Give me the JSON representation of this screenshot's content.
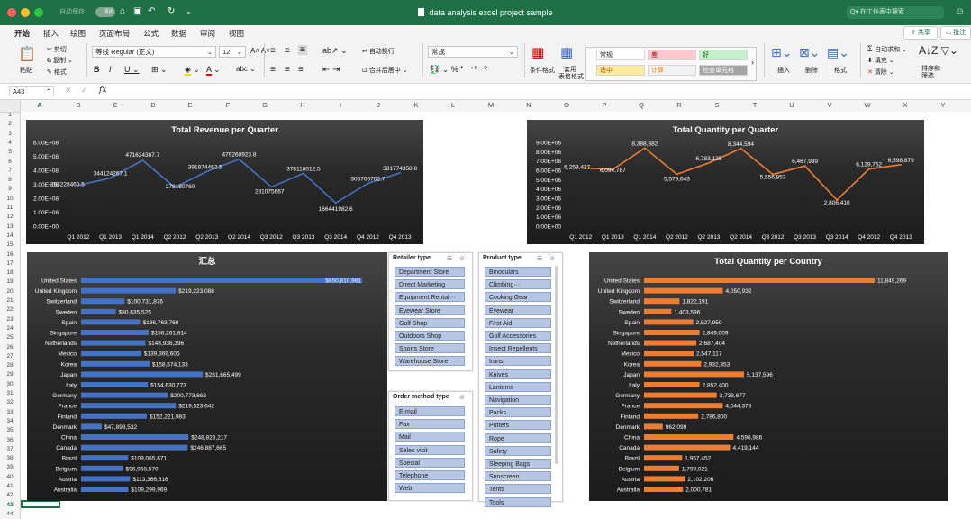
{
  "titlebar": {
    "title": "data analysis excel project sample",
    "autosave_label": "自动保存",
    "autosave_toggle": "关闭",
    "search_placeholder": "在工作表中搜索"
  },
  "menu": {
    "items": [
      "开始",
      "插入",
      "绘图",
      "页面布局",
      "公式",
      "数据",
      "审阅",
      "视图"
    ],
    "share": "共享",
    "comment": "批注"
  },
  "ribbon": {
    "paste": "粘贴",
    "cut": "剪切",
    "copy": "复制",
    "format_painter": "格式",
    "font_name": "等线 Regular (正文)",
    "font_size": "12",
    "wrap_text": "自动换行",
    "merge_center": "合并后居中",
    "number_format": "常规",
    "conditional_format": "条件格式",
    "table_format_1": "套用",
    "table_format_2": "表格格式",
    "styles": [
      {
        "label": "常规",
        "bg": "#ffffff",
        "fg": "#222222"
      },
      {
        "label": "差",
        "bg": "#ffc7ce",
        "fg": "#9c0006"
      },
      {
        "label": "好",
        "bg": "#c6efce",
        "fg": "#006100"
      },
      {
        "label": "适中",
        "bg": "#ffeb9c",
        "fg": "#9c5700"
      },
      {
        "label": "计算",
        "bg": "#f2f2f2",
        "fg": "#fa7d00"
      },
      {
        "label": "检查单元格",
        "bg": "#a5a5a5",
        "fg": "#ffffff"
      }
    ],
    "insert": "插入",
    "delete": "删除",
    "format": "格式",
    "autosum": "自动求和",
    "fill": "填充",
    "clear": "清除",
    "sort_filter_1": "排序和",
    "sort_filter_2": "筛选"
  },
  "formula_bar": {
    "cell_ref": "A43",
    "fx": "fx",
    "formula": ""
  },
  "columns": [
    "A",
    "B",
    "C",
    "D",
    "E",
    "F",
    "G",
    "H",
    "I",
    "J",
    "K",
    "L",
    "M",
    "N",
    "O",
    "P",
    "Q",
    "R",
    "S",
    "T",
    "U",
    "V",
    "W",
    "X",
    "Y"
  ],
  "rows": [
    "1",
    "2",
    "3",
    "4",
    "5",
    "6",
    "7",
    "8",
    "9",
    "10",
    "11",
    "12",
    "13",
    "14",
    "15",
    "16",
    "17",
    "18",
    "19",
    "20",
    "21",
    "22",
    "23",
    "24",
    "25",
    "26",
    "27",
    "28",
    "29",
    "30",
    "31",
    "32",
    "33",
    "34",
    "35",
    "36",
    "37",
    "38",
    "39",
    "40",
    "41",
    "42",
    "43",
    "44"
  ],
  "chart_data": [
    {
      "id": "revenue-quarter",
      "type": "line",
      "title": "Total Revenue per Quarter",
      "categories": [
        "Q1 2012",
        "Q1 2013",
        "Q1 2014",
        "Q2 2012",
        "Q2 2013",
        "Q2 2014",
        "Q3 2012",
        "Q3 2013",
        "Q3 2014",
        "Q4 2012",
        "Q4 2013"
      ],
      "values": [
        293228460.5,
        344124267.1,
        471624367.7,
        278180760,
        391874462.5,
        479260923.8,
        281075667,
        378118012.5,
        166441982.6,
        306706702.7,
        381774358.8
      ],
      "labels": [
        "293228460.5",
        "344124267.1",
        "471624367.7",
        "278180760",
        "391874462.5",
        "479260923.8",
        "281075667",
        "378118012.5",
        "166441982.6",
        "306706702.7",
        "381774358.8"
      ],
      "yticks": [
        "0.00E+00",
        "1.00E+08",
        "2.00E+08",
        "3.00E+08",
        "4.00E+08",
        "5.00E+08",
        "6.00E+08"
      ],
      "ylim": [
        0,
        600000000
      ],
      "color": "#4472c4"
    },
    {
      "id": "quantity-quarter",
      "type": "line",
      "title": "Total Quantity per Quarter",
      "categories": [
        "Q1 2012",
        "Q1 2013",
        "Q1 2014",
        "Q2 2012",
        "Q2 2013",
        "Q2 2014",
        "Q3 2012",
        "Q3 2013",
        "Q3 2014",
        "Q4 2012",
        "Q4 2013"
      ],
      "values": [
        6258427,
        6094787,
        8388882,
        5579643,
        6783135,
        8344594,
        5556853,
        6467989,
        2806410,
        6129762,
        6598879
      ],
      "labels": [
        "6,258,427",
        "6,094,787",
        "8,388,882",
        "5,579,643",
        "6,783,135",
        "8,344,594",
        "5,556,853",
        "6,467,989",
        "2,806,410",
        "6,129,762",
        "6,598,879"
      ],
      "yticks": [
        "0.00E+00",
        "1.00E+06",
        "2.00E+06",
        "3.00E+06",
        "4.00E+06",
        "5.00E+06",
        "6.00E+06",
        "7.00E+06",
        "8.00E+06",
        "9.00E+06"
      ],
      "ylim": [
        0,
        9000000
      ],
      "color": "#ed7d31"
    },
    {
      "id": "revenue-country",
      "type": "bar",
      "orientation": "horizontal",
      "title": "汇总",
      "categories": [
        "United States",
        "United Kingdom",
        "Switzerland",
        "Sweden",
        "Spain",
        "Singapore",
        "Netherlands",
        "Mexico",
        "Korea",
        "Japan",
        "Italy",
        "Germany",
        "France",
        "Finland",
        "Denmark",
        "China",
        "Canada",
        "Brazil",
        "Belgium",
        "Austria",
        "Australia"
      ],
      "values": [
        650810961,
        219223088,
        100731876,
        80635525,
        136763769,
        156261814,
        148936396,
        139369605,
        158574133,
        281665499,
        154630773,
        200773663,
        219523642,
        152221983,
        47898532,
        248823217,
        246887665,
        109065671,
        96958570,
        113366616,
        109299969
      ],
      "labels": [
        "$650,810,961",
        "$219,223,088",
        "$100,731,876",
        "$80,635,525",
        "$136,763,769",
        "$156,261,814",
        "$148,936,396",
        "$139,369,605",
        "$158,574,133",
        "$281,665,499",
        "$154,630,773",
        "$200,773,663",
        "$219,523,642",
        "$152,221,983",
        "$47,898,532",
        "$248,823,217",
        "$246,887,665",
        "$109,065,671",
        "$96,958,570",
        "$113,366,616",
        "$109,299,969"
      ],
      "color": "#4472c4"
    },
    {
      "id": "quantity-country",
      "type": "bar",
      "orientation": "horizontal",
      "title": "Total Quantity per Country",
      "categories": [
        "United States",
        "United Kingdom",
        "Switzerland",
        "Sweden",
        "Spain",
        "Singapore",
        "Netherlands",
        "Mexico",
        "Korea",
        "Japan",
        "Italy",
        "Germany",
        "France",
        "Finland",
        "Denmark",
        "China",
        "Canada",
        "Brazil",
        "Belgium",
        "Austria",
        "Australia"
      ],
      "values": [
        11849269,
        4050932,
        1822191,
        1403596,
        2527950,
        2849009,
        2687404,
        2547117,
        2932353,
        5137596,
        2852400,
        3733677,
        4044378,
        2786800,
        962099,
        4596986,
        4419144,
        1957452,
        1799021,
        2102206,
        2000781
      ],
      "labels": [
        "11,849,269",
        "4,050,932",
        "1,822,191",
        "1,403,596",
        "2,527,950",
        "2,849,009",
        "2,687,404",
        "2,547,117",
        "2,932,353",
        "5,137,596",
        "2,852,400",
        "3,733,677",
        "4,044,378",
        "2,786,800",
        "962,099",
        "4,596,986",
        "4,419,144",
        "1,957,452",
        "1,799,021",
        "2,102,206",
        "2,000,781"
      ],
      "color": "#ed7d31"
    }
  ],
  "slicers": {
    "retailer": {
      "title": "Retailer type",
      "items": [
        "Department Store",
        "Direct Marketing",
        "Equipment Rental···",
        "Eyewear Store",
        "Golf Shop",
        "Outdoors Shop",
        "Sports Store",
        "Warehouse Store"
      ]
    },
    "order": {
      "title": "Order method type",
      "items": [
        "E-mail",
        "Fax",
        "Mail",
        "Sales visit",
        "Special",
        "Telephone",
        "Web"
      ]
    },
    "product": {
      "title": "Product type",
      "items": [
        "Binoculars",
        "Climbing···",
        "Cooking Gear",
        "Eyewear",
        "First Aid",
        "Golf Accessories",
        "Insect Repellents",
        "Irons",
        "Knives",
        "Lanterns",
        "Navigation",
        "Packs",
        "Putters",
        "Rope",
        "Safety",
        "Sleeping Bags",
        "Sunscreen",
        "Tents",
        "Tools"
      ]
    }
  }
}
